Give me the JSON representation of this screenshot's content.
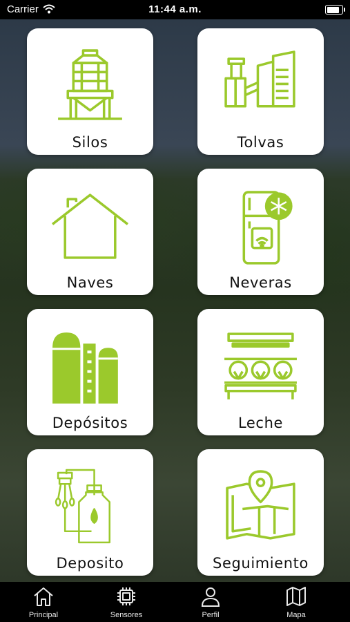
{
  "status_bar": {
    "carrier": "Carrier",
    "time": "11:44 a.m.",
    "battery_level": 0.92
  },
  "theme": {
    "accent": "#9bc92c",
    "card_bg": "#ffffff",
    "tabbar_bg": "#000000"
  },
  "cards": [
    {
      "label": "Silos",
      "icon": "silo-icon"
    },
    {
      "label": "Tolvas",
      "icon": "hopper-icon"
    },
    {
      "label": "Naves",
      "icon": "house-icon"
    },
    {
      "label": "Neveras",
      "icon": "fridge-icon"
    },
    {
      "label": "Depósitos",
      "icon": "tank-icon"
    },
    {
      "label": "Leche",
      "icon": "milking-sheep-icon"
    },
    {
      "label": "Deposito",
      "icon": "milk-tank-icon"
    },
    {
      "label": "Seguimiento",
      "icon": "map-pin-icon"
    }
  ],
  "tabs": [
    {
      "label": "Principal",
      "icon": "home-icon"
    },
    {
      "label": "Sensores",
      "icon": "chip-icon"
    },
    {
      "label": "Perfil",
      "icon": "user-icon"
    },
    {
      "label": "Mapa",
      "icon": "map-icon"
    }
  ]
}
